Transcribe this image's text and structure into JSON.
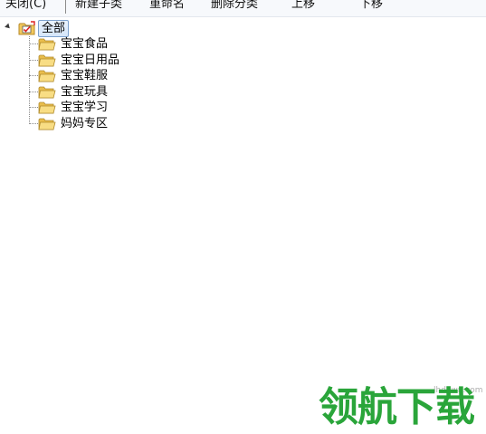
{
  "toolbar": {
    "close_label": "关闭(C)",
    "new_child_label": "新建子类",
    "rename_label": "重命名",
    "delete_label": "删除分类",
    "move_up_label": "上移",
    "move_down_label": "下移"
  },
  "tree": {
    "root": {
      "label": "全部",
      "expanded": true,
      "icon": "checked-folder-icon"
    },
    "items": [
      {
        "label": "宝宝食品",
        "icon": "folder-icon"
      },
      {
        "label": "宝宝日用品",
        "icon": "folder-icon"
      },
      {
        "label": "宝宝鞋服",
        "icon": "folder-icon"
      },
      {
        "label": "宝宝玩具",
        "icon": "folder-icon"
      },
      {
        "label": "宝宝学习",
        "icon": "folder-icon"
      },
      {
        "label": "妈妈专区",
        "icon": "folder-icon"
      }
    ]
  },
  "watermark": {
    "site": "lhdown.com",
    "brand": "领航下载"
  },
  "colors": {
    "watermark_green": "#2aa53a",
    "selection_border": "#7da2ce",
    "folder_yellow": "#f5d36b"
  }
}
